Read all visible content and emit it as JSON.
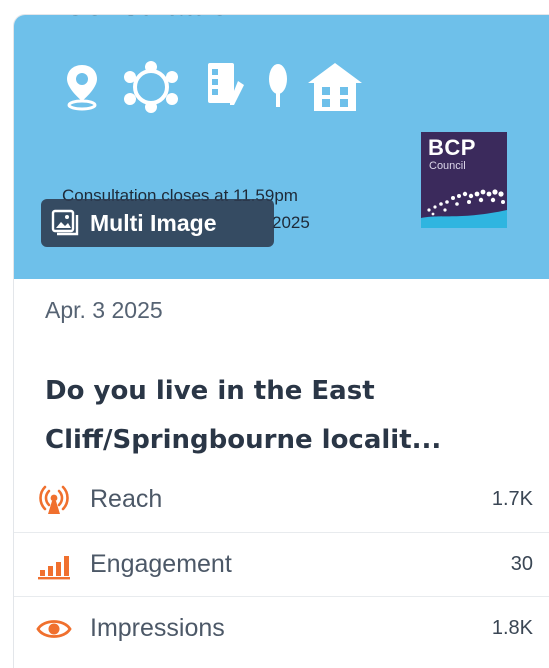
{
  "hero": {
    "heading_partial": "Consultation",
    "closes_line1": "Consultation closes at 11.59pm",
    "closes_line2": "2025",
    "logo_title": "BCP",
    "logo_subtitle": "Council",
    "background_color": "#6ec0ea",
    "icons": [
      "location-pin-icon",
      "community-circle-icon",
      "checklist-form-icon",
      "tree-icon",
      "house-icon"
    ]
  },
  "badge": {
    "label": "Multi Image",
    "icon": "images-icon"
  },
  "post": {
    "date": "Apr. 3 2025",
    "title_line1": "Do you live in the East",
    "title_line2": "Cliff/Springbourne localit..."
  },
  "metrics": [
    {
      "label": "Reach",
      "value": "1.7K",
      "icon": "broadcast-tower-icon"
    },
    {
      "label": "Engagement",
      "value": "30",
      "icon": "bar-chart-icon"
    },
    {
      "label": "Impressions",
      "value": "1.8K",
      "icon": "eye-icon"
    }
  ],
  "accent_color": "#f0702e"
}
